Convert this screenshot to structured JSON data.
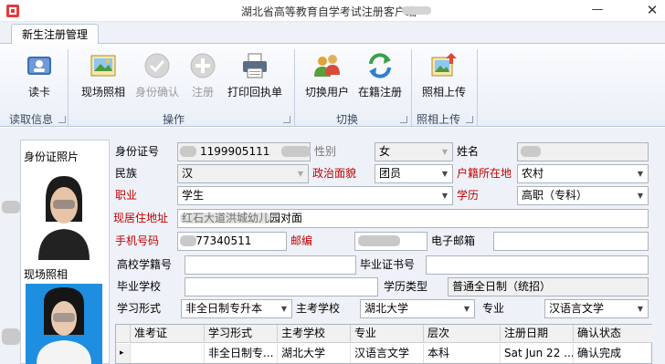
{
  "window": {
    "title": "湖北省高等教育自学考试注册客户端 - ",
    "minimize_glyph": "—",
    "close_glyph": "✕"
  },
  "tab": {
    "label": "新生注册管理"
  },
  "ribbon": {
    "buttons": {
      "read_card": "读卡",
      "live_photo": "现场照相",
      "id_confirm": "身份确认",
      "register": "注册",
      "print_receipt": "打印回执单",
      "switch_user": "切换用户",
      "enrolled_register": "在籍注册",
      "upload_photo": "照相上传"
    },
    "groups": {
      "read_info": "读取信息",
      "operation": "操作",
      "switch": "切换",
      "upload": "照相上传"
    }
  },
  "photos": {
    "id_photo_label": "身份证照片",
    "live_photo_label": "现场照相"
  },
  "form": {
    "id_number": {
      "label": "身份证号",
      "value": "1199905111"
    },
    "gender": {
      "label": "性别",
      "value": "女"
    },
    "name": {
      "label": "姓名",
      "value": ""
    },
    "ethnicity": {
      "label": "民族",
      "value": "汉"
    },
    "politics": {
      "label": "政治面貌",
      "value": "团员"
    },
    "hukou": {
      "label": "户籍所在地",
      "value": "农村"
    },
    "occupation": {
      "label": "职业",
      "value": "学生"
    },
    "education": {
      "label": "学历",
      "value": "高职（专科）"
    },
    "address": {
      "label": "现居住地址",
      "value": "红石大道洪城幼儿园对面"
    },
    "phone": {
      "label": "手机号码",
      "value": "1177340511"
    },
    "postcode": {
      "label": "邮编",
      "value": ""
    },
    "email": {
      "label": "电子邮箱",
      "value": ""
    },
    "college_no": {
      "label": "高校学籍号",
      "value": ""
    },
    "graduation_no": {
      "label": "毕业证书号",
      "value": ""
    },
    "grad_school": {
      "label": "毕业学校",
      "value": ""
    },
    "school_type": {
      "label": "学历类型",
      "value": "普通全日制（统招）"
    },
    "study_form": {
      "label": "学习形式",
      "value": "非全日制专升本"
    },
    "host_school": {
      "label": "主考学校",
      "value": "湖北大学"
    },
    "major": {
      "label": "专业",
      "value": "汉语言文学"
    }
  },
  "grid": {
    "columns": [
      "准考证",
      "学习形式",
      "主考学校",
      "专业",
      "层次",
      "注册日期",
      "确认状态"
    ],
    "rows": [
      [
        "",
        "非全日制专...",
        "湖北大学",
        "汉语言文学",
        "本科",
        "Sat Jun 22 ...",
        "确认完成"
      ]
    ],
    "row_marker": "▸"
  }
}
